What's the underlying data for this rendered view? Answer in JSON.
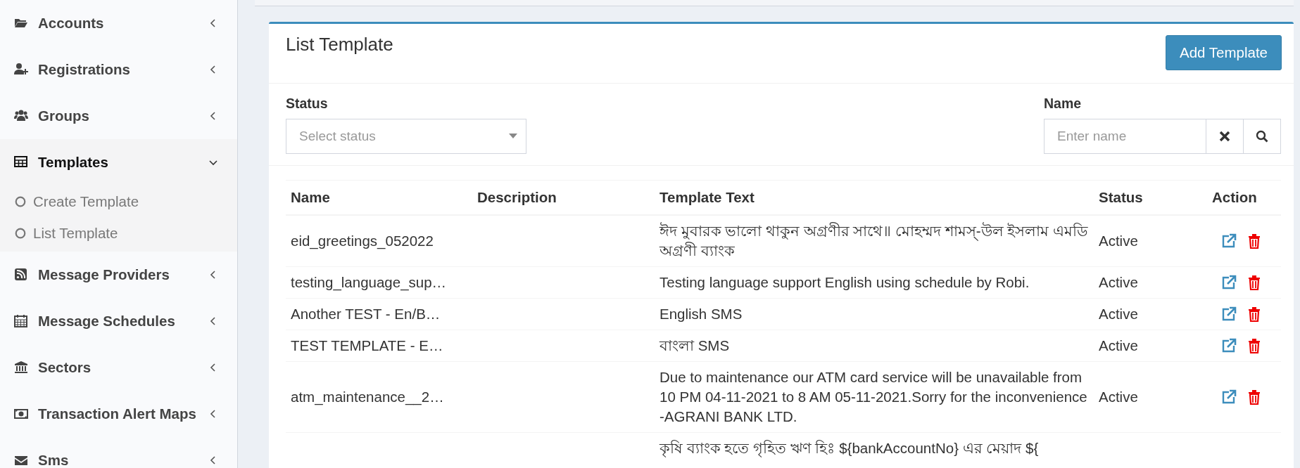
{
  "sidebar": {
    "items": [
      {
        "label": "Accounts",
        "expanded": false
      },
      {
        "label": "Registrations",
        "expanded": false
      },
      {
        "label": "Groups",
        "expanded": false
      },
      {
        "label": "Templates",
        "expanded": true,
        "children": [
          {
            "label": "Create Template"
          },
          {
            "label": "List Template"
          }
        ]
      },
      {
        "label": "Message Providers",
        "expanded": false
      },
      {
        "label": "Message Schedules",
        "expanded": false
      },
      {
        "label": "Sectors",
        "expanded": false
      },
      {
        "label": "Transaction Alert Maps",
        "expanded": false
      },
      {
        "label": "Sms",
        "expanded": false
      }
    ]
  },
  "card": {
    "title": "List Template",
    "add_button": "Add Template",
    "filters": {
      "status": {
        "label": "Status",
        "placeholder": "Select status"
      },
      "name": {
        "label": "Name",
        "placeholder": "Enter name"
      }
    },
    "table": {
      "columns": [
        "Name",
        "Description",
        "Template Text",
        "Status",
        "Action"
      ],
      "rows": [
        {
          "name": "eid_greetings_052022",
          "template_text": "ঈদ মুবারক ভালো থাকুন অগ্রণীর সাথে॥ মোহম্মদ শামস্-উল ইসলাম এমডি অগ্রণী ব্যাংক",
          "status": "Active"
        },
        {
          "name": "testing_language_sup…",
          "template_text": "Testing language support English using schedule by Robi.",
          "status": "Active"
        },
        {
          "name": "Another TEST - En/B…",
          "template_text": "English SMS",
          "status": "Active"
        },
        {
          "name": "TEST TEMPLATE - E…",
          "template_text": "বাংলা SMS",
          "status": "Active"
        },
        {
          "name": "atm_maintenance__2…",
          "template_text": "Due to maintenance our ATM card service will be unavailable from 10 PM 04-11-2021 to 8 AM 05-11-2021.Sorry for the inconvenience -AGRANI BANK LTD.",
          "status": "Active"
        },
        {
          "template_text": "কৃষি ব্যাংক হতে গৃহিত ঋণ হিঃ ${bankAccountNo} এর মেয়াদ ${"
        }
      ]
    }
  }
}
